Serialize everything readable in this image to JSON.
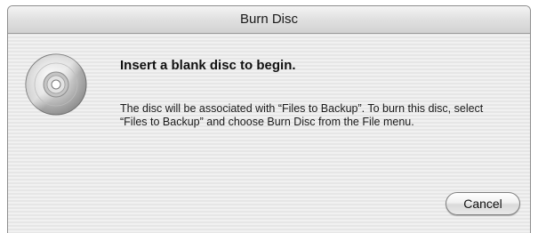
{
  "window": {
    "title": "Burn Disc"
  },
  "dialog": {
    "icon": "cd-disc-icon",
    "heading": "Insert a blank disc to begin.",
    "message": "The disc will be associated with “Files to Backup”. To burn this disc, select “Files to Backup” and choose Burn Disc from the File menu."
  },
  "buttons": {
    "cancel_label": "Cancel"
  }
}
